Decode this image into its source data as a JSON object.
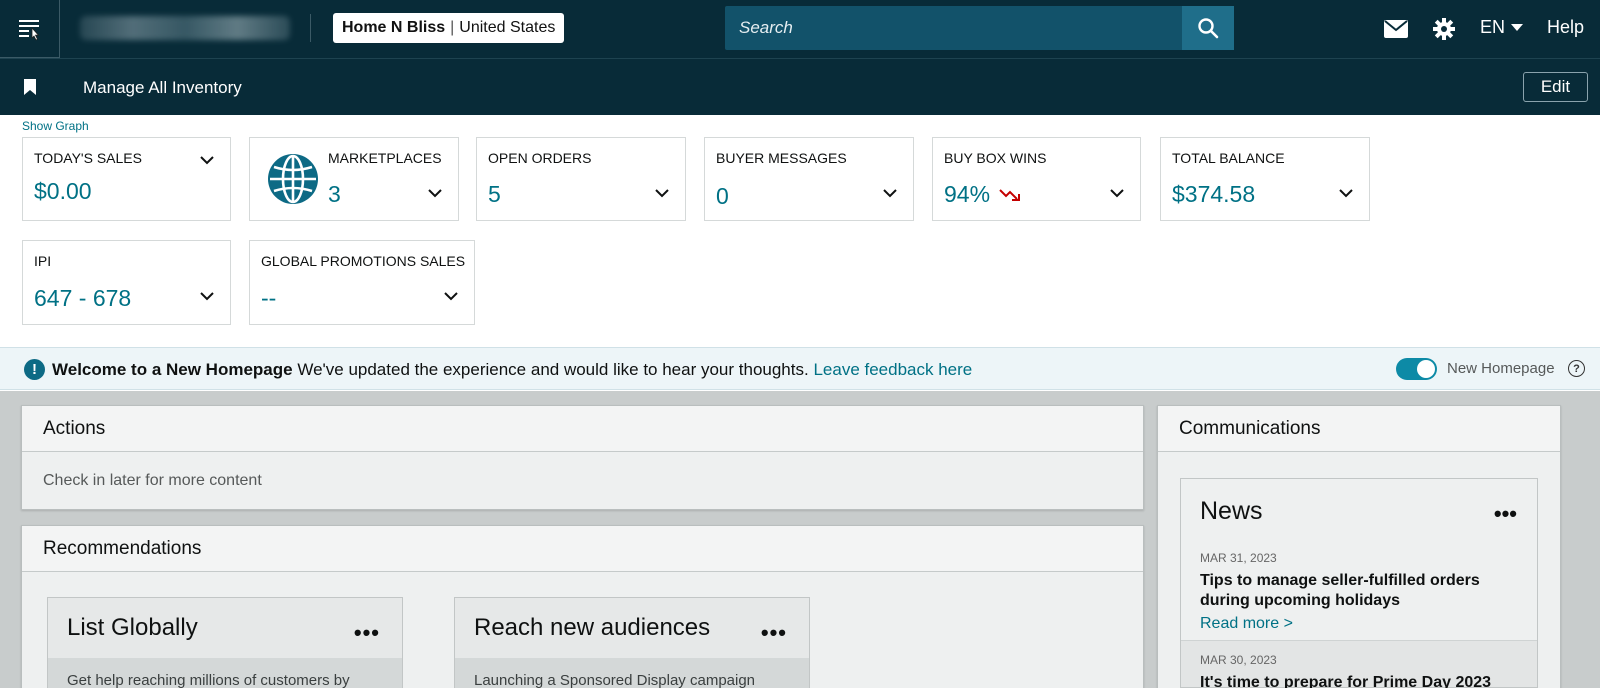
{
  "topbar": {
    "store_name": "Home N Bliss",
    "store_region": "United States",
    "search_placeholder": "Search",
    "language": "EN",
    "help": "Help"
  },
  "subbar": {
    "link": "Manage All Inventory",
    "edit": "Edit"
  },
  "show_graph": "Show Graph",
  "metrics": [
    {
      "label": "TODAY'S SALES",
      "value": "$0.00"
    },
    {
      "label": "MARKETPLACES",
      "value": "3"
    },
    {
      "label": "OPEN ORDERS",
      "value": "5"
    },
    {
      "label": "BUYER MESSAGES",
      "value": "0"
    },
    {
      "label": "BUY BOX WINS",
      "value": "94%"
    },
    {
      "label": "TOTAL BALANCE",
      "value": "$374.58"
    },
    {
      "label": "IPI",
      "value": "647 - 678"
    },
    {
      "label": "GLOBAL PROMOTIONS SALES",
      "value": "--"
    }
  ],
  "banner": {
    "title": "Welcome to a New Homepage",
    "message": "We've updated the experience and would like to hear your thoughts.",
    "link": "Leave feedback here",
    "toggle_label": "New Homepage",
    "toggle_on": true
  },
  "actions": {
    "title": "Actions",
    "empty": "Check in later for more content"
  },
  "recommendations": {
    "title": "Recommendations",
    "cards": [
      {
        "title": "List Globally",
        "desc": "Get help reaching millions of customers by"
      },
      {
        "title": "Reach new audiences",
        "desc": "Launching a Sponsored Display campaign"
      }
    ]
  },
  "communications": {
    "title": "Communications",
    "news": {
      "title": "News",
      "items": [
        {
          "date": "MAR 31, 2023",
          "headline": "Tips to manage seller-fulfilled orders during upcoming holidays",
          "more": "Read more >"
        },
        {
          "date": "MAR 30, 2023",
          "headline": "It's time to prepare for Prime Day 2023"
        }
      ]
    }
  },
  "colors": {
    "nav_bg": "#082b38",
    "accent": "#007185",
    "toggle": "#0d8aa6",
    "trend_down": "#c40000"
  }
}
